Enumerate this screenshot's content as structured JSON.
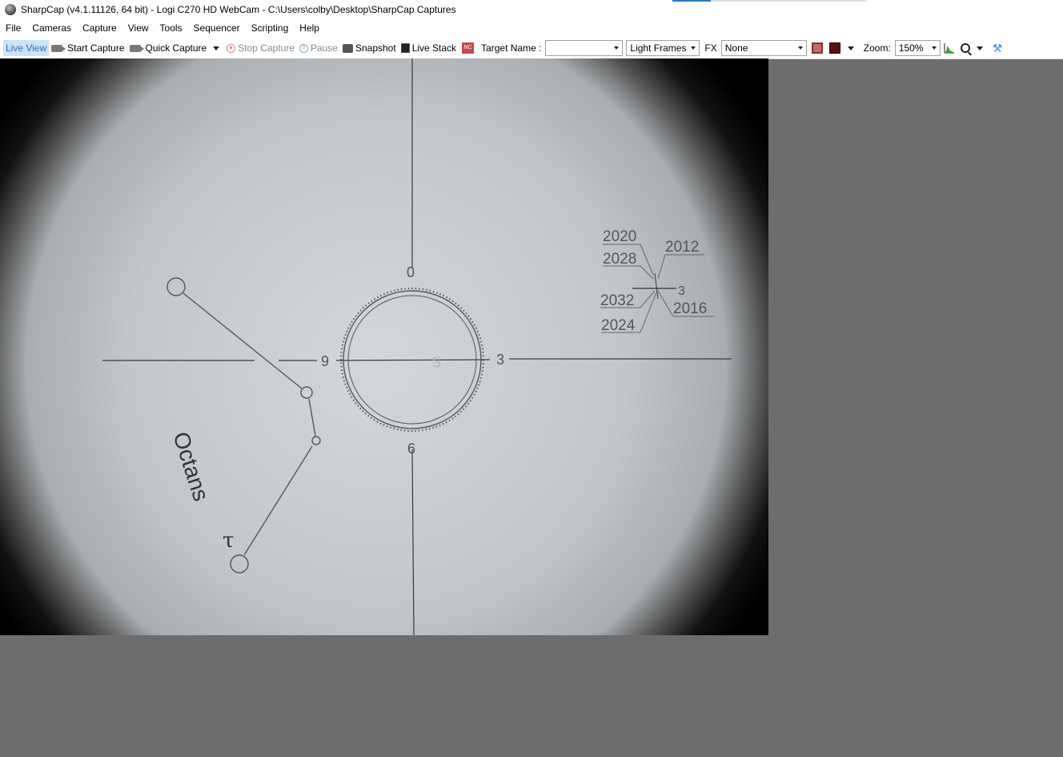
{
  "window": {
    "title": "SharpCap (v4.1.11126, 64 bit) - Logi C270 HD WebCam - C:\\Users\\colby\\Desktop\\SharpCap Captures"
  },
  "menu": [
    "File",
    "Cameras",
    "Capture",
    "View",
    "Tools",
    "Sequencer",
    "Scripting",
    "Help"
  ],
  "toolbar": {
    "live_view": "Live View",
    "start_capture": "Start Capture",
    "quick_capture": "Quick Capture",
    "stop_capture": "Stop Capture",
    "pause": "Pause",
    "snapshot": "Snapshot",
    "live_stack": "Live Stack",
    "target_name_label": "Target Name :",
    "target_name_value": "",
    "frame_type": "Light Frames",
    "fx_label": "FX",
    "fx_value": "None",
    "zoom_label": "Zoom:",
    "zoom_value": "150%"
  },
  "camera_view": {
    "reticle": {
      "clock_top": "0",
      "clock_left": "9",
      "clock_right": "3",
      "clock_bottom": "6"
    },
    "constellation_label": "Octans",
    "star_label": "τ",
    "years": {
      "y2020": "2020",
      "y2028": "2028",
      "y2032": "2032",
      "y2024": "2024",
      "y2012": "2012",
      "y2016": "2016",
      "small_3": "3"
    }
  }
}
